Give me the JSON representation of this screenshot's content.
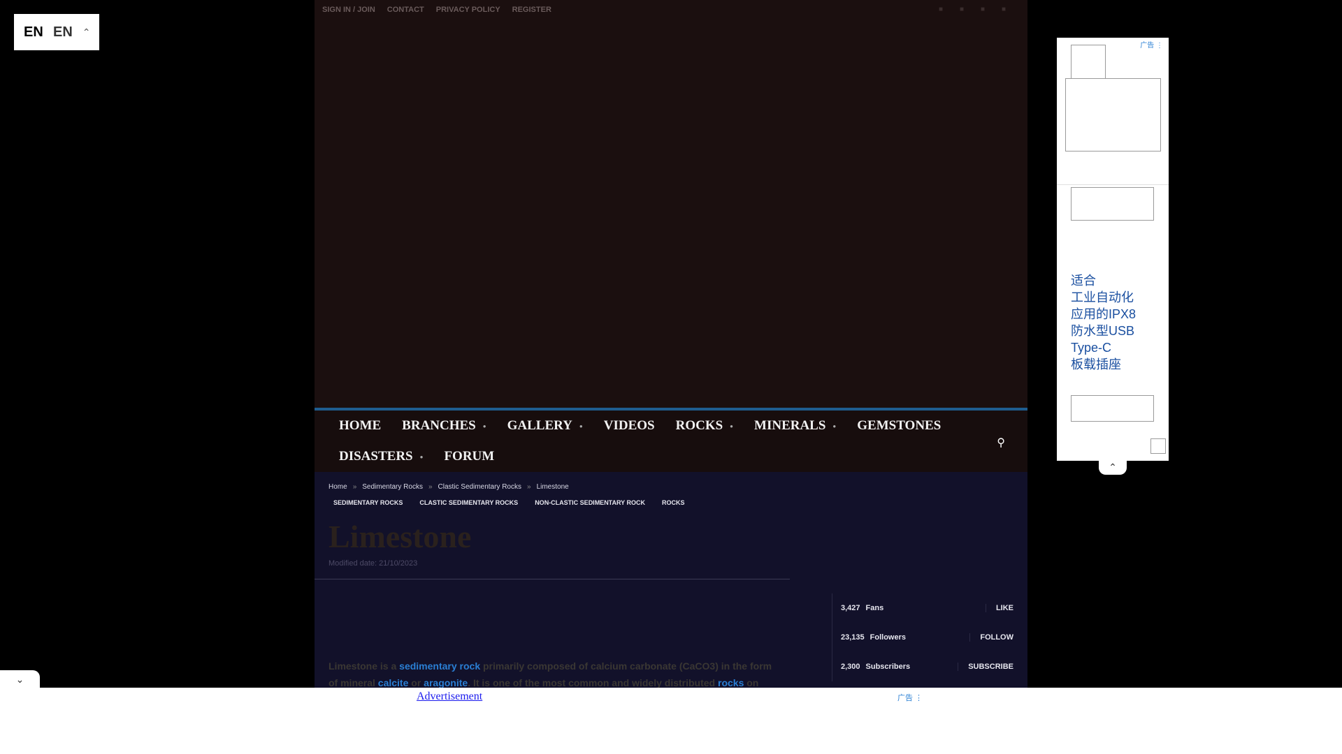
{
  "language": {
    "flag_text": "EN",
    "code": "EN"
  },
  "topbar": {
    "links": [
      "SIGN IN / JOIN",
      "CONTACT",
      "PRIVACY POLICY",
      "REGISTER"
    ]
  },
  "nav": {
    "row1": [
      "HOME",
      "BRANCHES",
      "GALLERY",
      "VIDEOS",
      "ROCKS",
      "MINERALS",
      "GEMSTONES"
    ],
    "row2": [
      "DISASTERS",
      "FORUM"
    ]
  },
  "breadcrumb": [
    "Home",
    "Sedimentary Rocks",
    "Clastic Sedimentary Rocks",
    "Limestone"
  ],
  "tags": [
    "SEDIMENTARY ROCKS",
    "CLASTIC SEDIMENTARY ROCKS",
    "NON-CLASTIC SEDIMENTARY ROCK",
    "ROCKS"
  ],
  "article": {
    "title": "Limestone",
    "modified": "Modified date: 21/10/2023",
    "p1": "Limestone is a ",
    "l1": "sedimentary rock",
    "p2": " primarily composed of calcium carbonate (CaCO3) in the form of mineral ",
    "l2": "calcite",
    "p3": " or ",
    "l3": "aragonite",
    "p4": ". It is one of the most common and widely distributed ",
    "l4": "rocks",
    "p5": " on"
  },
  "social": [
    {
      "count": "3,427",
      "label": "Fans",
      "action": "LIKE"
    },
    {
      "count": "23,135",
      "label": "Followers",
      "action": "FOLLOW"
    },
    {
      "count": "2,300",
      "label": "Subscribers",
      "action": "SUBSCRIBE"
    }
  ],
  "ads": {
    "right_label": "广告 ⋮",
    "right_text": "适合\n工业自动化\n应用的IPX8\n防水型USB\nType-C\n板载插座",
    "bottom_link": "Advertisement",
    "bottom_label": "广告 ⋮"
  }
}
